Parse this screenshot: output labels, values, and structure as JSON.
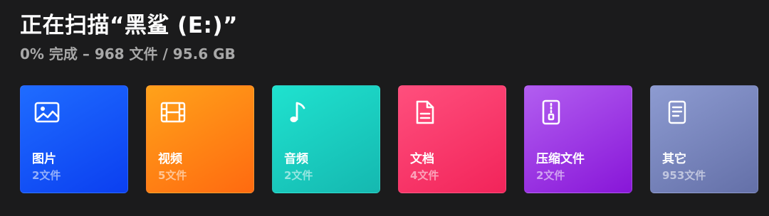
{
  "header": {
    "title": "正在扫描“黑鲨 (E:)”",
    "subtitle": "0% 完成 – 968 文件 / 95.6 GB"
  },
  "categories": [
    {
      "label": "图片",
      "count": "2文件",
      "icon": "image-icon",
      "color": "#1456ff"
    },
    {
      "label": "视频",
      "count": "5文件",
      "icon": "film-icon",
      "color": "#ff8a14"
    },
    {
      "label": "音频",
      "count": "2文件",
      "icon": "music-note-icon",
      "color": "#1bcfc4"
    },
    {
      "label": "文档",
      "count": "4文件",
      "icon": "document-icon",
      "color": "#fb3a6c"
    },
    {
      "label": "压缩文件",
      "count": "2文件",
      "icon": "archive-zip-icon",
      "color": "#a33be6"
    },
    {
      "label": "其它",
      "count": "953文件",
      "icon": "other-file-icon",
      "color": "#7885bf"
    }
  ]
}
